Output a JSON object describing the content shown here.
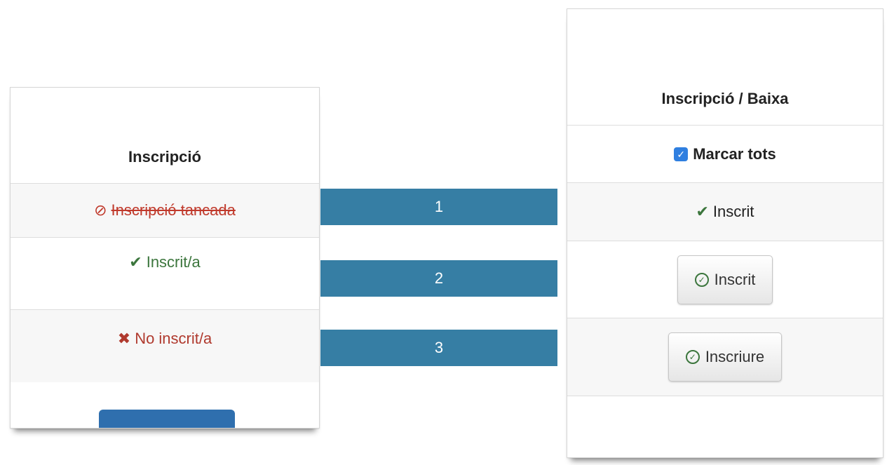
{
  "left": {
    "header": "Inscripció",
    "closed_label": "Inscripció tancada",
    "inscrit_label": "Inscrit/a",
    "noinscrit_label": "No inscrit/a"
  },
  "bars": [
    "1",
    "2",
    "3"
  ],
  "right": {
    "header": "Inscripció / Baixa",
    "mark_all_label": "Marcar tots",
    "inscrit_label": "Inscrit",
    "inscrit_button_label": "Inscrit",
    "inscriure_button_label": "Inscriure"
  },
  "icons": {
    "ban": "ban-icon",
    "check": "check-icon",
    "x": "x-icon",
    "ok_circle": "ok-circle-icon",
    "checkbox": "checkbox-checked"
  },
  "colors": {
    "bar": "#367ea4",
    "success": "#3c763d",
    "danger": "#b03a2e",
    "checkbox": "#2f7fe0",
    "primary_button": "#2f6fae"
  }
}
